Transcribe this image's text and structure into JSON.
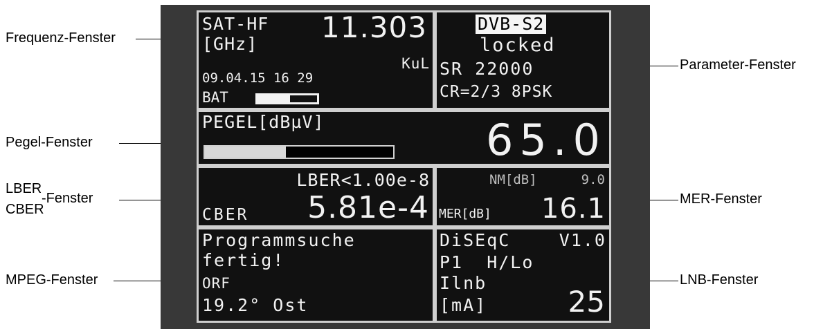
{
  "labels": {
    "frequency": "Frequenz-Fenster",
    "level": "Pegel-Fenster",
    "lber_top": "LBER",
    "ber_suffix": "-Fenster",
    "cber_bottom": "CBER",
    "mpeg": "MPEG-Fenster",
    "parameter": "Parameter-Fenster",
    "mer": "MER-Fenster",
    "lnb": "LNB-Fenster"
  },
  "frequency_window": {
    "band": "SAT-HF",
    "unit": "[GHz]",
    "value": "11.303",
    "sub_band": "KuL",
    "datetime": "09.04.15 16 29",
    "battery_label": "BAT",
    "battery_level": 0.55
  },
  "parameter_window": {
    "standard": "DVB-S2",
    "status": "locked",
    "symbol_rate": "SR 22000",
    "code_rate": "CR=2/3 8PSK"
  },
  "level_window": {
    "label": "PEGEL[dBµV]",
    "value": "65.0",
    "bar_fill": 0.43
  },
  "ber_window": {
    "lber": "LBER<1.00e-8",
    "cber_label": "CBER",
    "cber_value": "5.81e-4"
  },
  "mer_window": {
    "nm_label": "NM[dB]",
    "nm_value": "9.0",
    "mer_label": "MER[dB]",
    "mer_value": "16.1"
  },
  "mpeg_window": {
    "line1": "Programmsuche",
    "line2": "fertig!",
    "line3": "ORF",
    "line4": "19.2° Ost"
  },
  "lnb_window": {
    "diseqc": "DiSEqC",
    "version": "V1.0",
    "port": "P1  H/Lo",
    "current_label": "Ilnb",
    "current_unit": "[mA]",
    "current_value": "25"
  }
}
